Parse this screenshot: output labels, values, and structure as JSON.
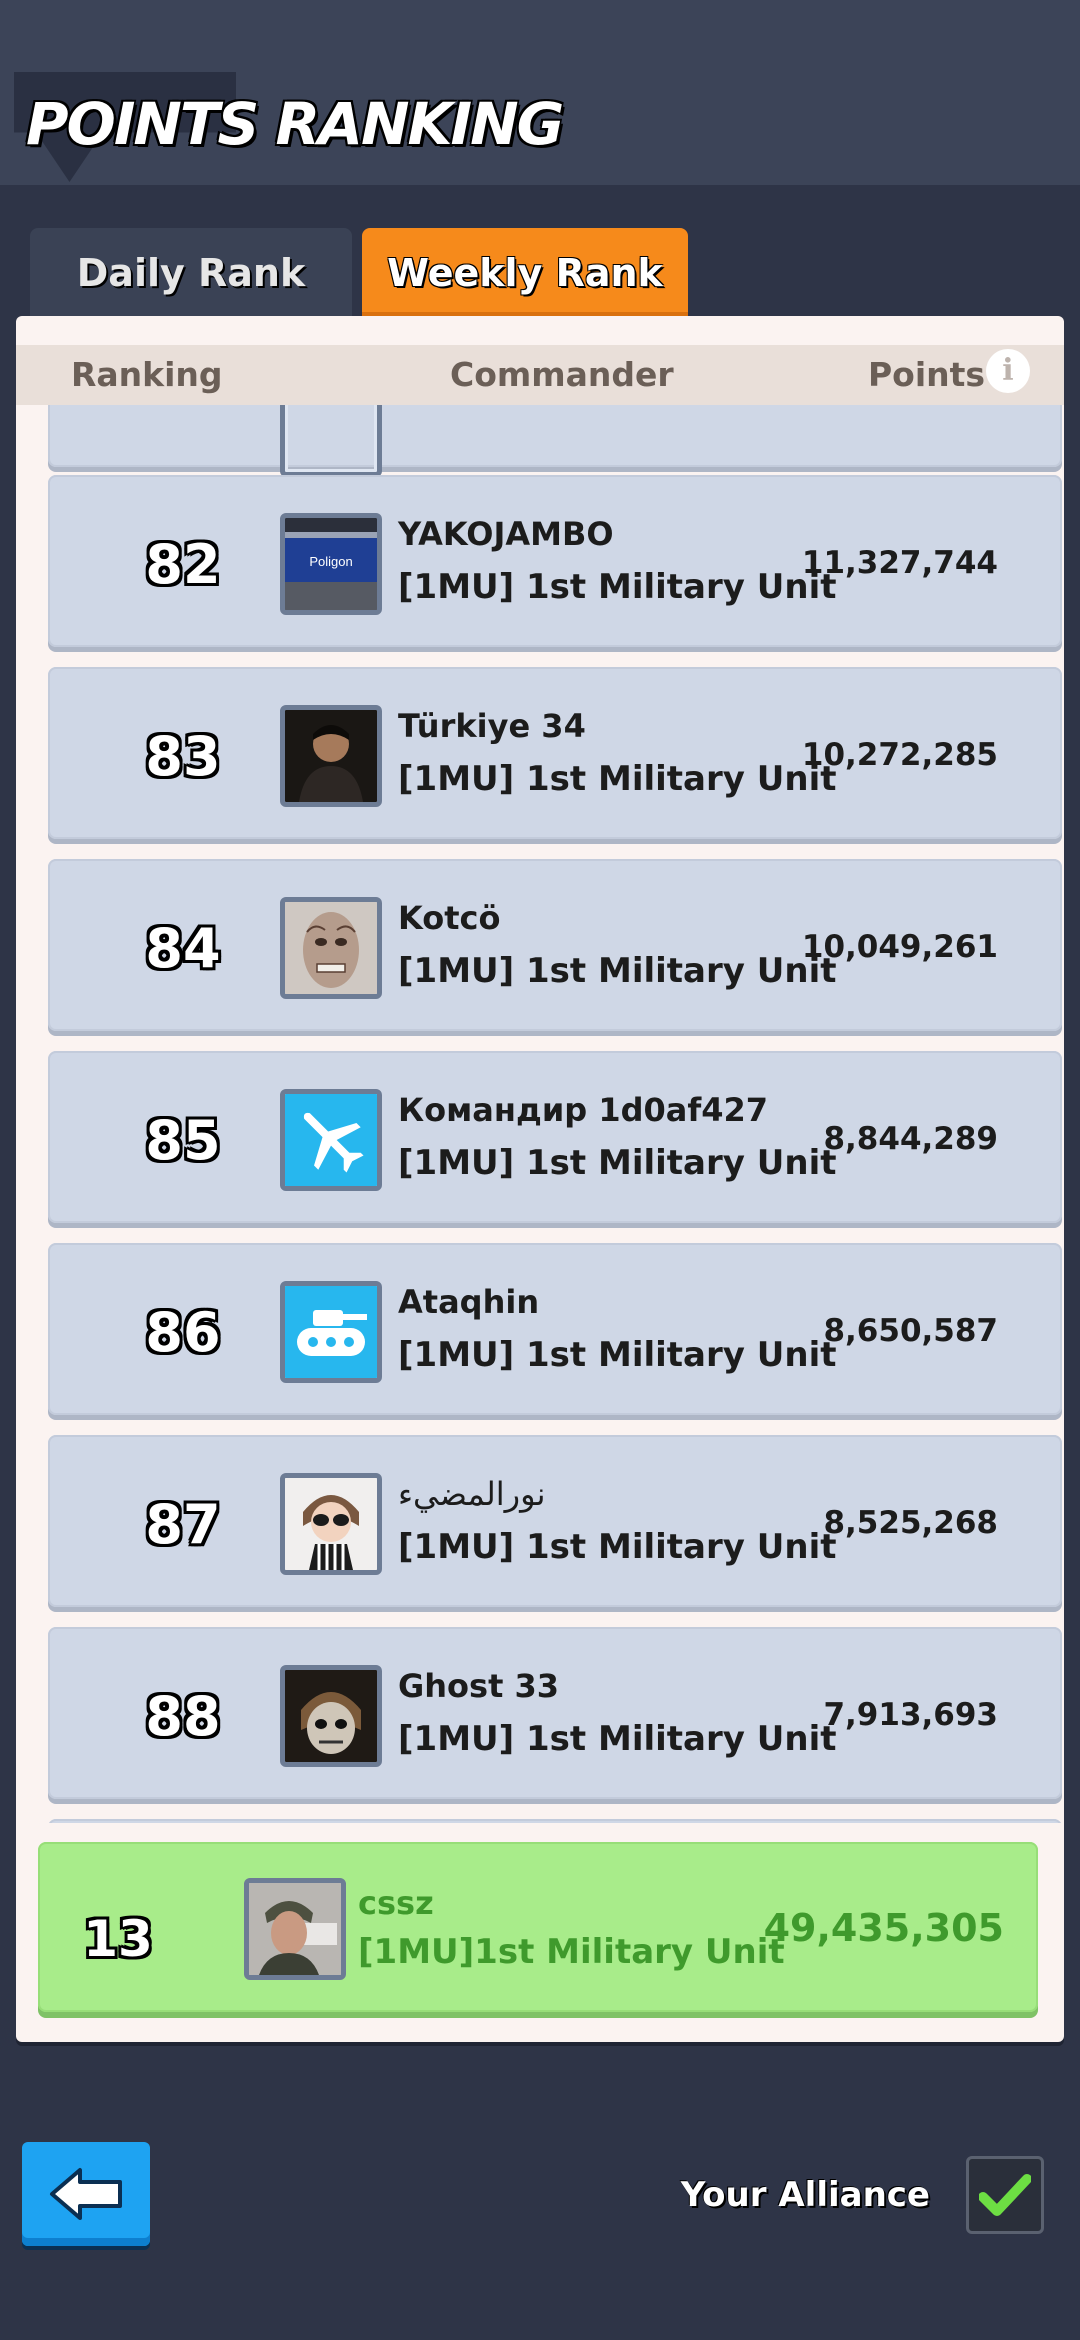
{
  "header": {
    "title": "POINTS RANKING"
  },
  "tabs": [
    {
      "label": "Daily Rank",
      "active": false
    },
    {
      "label": "Weekly Rank",
      "active": true
    }
  ],
  "columns": {
    "rank": "Ranking",
    "commander": "Commander",
    "points": "Points"
  },
  "rows": [
    {
      "rank": "82",
      "name": "YAKOJAMBO",
      "alliance": "[1MU] 1st Military Unit",
      "points": "11,327,744",
      "avatar": "subway-sign-photo"
    },
    {
      "rank": "83",
      "name": "Türkiye 34",
      "alliance": "[1MU] 1st Military Unit",
      "points": "10,272,285",
      "avatar": "man-in-suit-photo"
    },
    {
      "rank": "84",
      "name": "Kotcö",
      "alliance": "[1MU] 1st Military Unit",
      "points": "10,049,261",
      "avatar": "tattooed-face-photo"
    },
    {
      "rank": "85",
      "name": "Командир 1d0af427",
      "alliance": "[1MU] 1st Military Unit",
      "points": "8,844,289",
      "avatar": "airplane-icon"
    },
    {
      "rank": "86",
      "name": "Ataqhin",
      "alliance": "[1MU] 1st Military Unit",
      "points": "8,650,587",
      "avatar": "tank-icon"
    },
    {
      "rank": "87",
      "name": "نورالمضيء",
      "alliance": "[1MU] 1st Military Unit",
      "points": "8,525,268",
      "avatar": "cartoon-girl-photo"
    },
    {
      "rank": "88",
      "name": "Ghost 33",
      "alliance": "[1MU] 1st Military Unit",
      "points": "7,913,693",
      "avatar": "ghost-soldier-photo"
    }
  ],
  "my_row": {
    "rank": "13",
    "name": "cssz",
    "alliance": "[1MU]1st Military Unit",
    "points": "49,435,305"
  },
  "footer": {
    "your_alliance_label": "Your Alliance",
    "your_alliance_checked": true
  },
  "colors": {
    "accent_orange": "#f68a1b",
    "row_blue": "#cfd7e6",
    "my_row_green": "#a8ec8a",
    "my_text_green": "#3f9a2c",
    "back_blue": "#1ea3f2"
  }
}
